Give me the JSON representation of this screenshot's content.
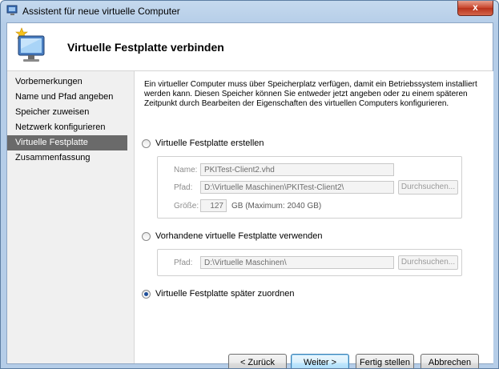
{
  "window": {
    "title": "Assistent für neue virtuelle Computer",
    "close_glyph": "x"
  },
  "header": {
    "title": "Virtuelle Festplatte verbinden"
  },
  "nav": {
    "items": [
      {
        "label": "Vorbemerkungen",
        "active": false
      },
      {
        "label": "Name und Pfad angeben",
        "active": false
      },
      {
        "label": "Speicher zuweisen",
        "active": false
      },
      {
        "label": "Netzwerk konfigurieren",
        "active": false
      },
      {
        "label": "Virtuelle Festplatte verbinden",
        "active": true
      },
      {
        "label": "Zusammenfassung",
        "active": false
      }
    ]
  },
  "content": {
    "description": "Ein virtueller Computer muss über Speicherplatz verfügen, damit ein Betriebssystem installiert werden kann. Diesen Speicher können Sie entweder jetzt angeben oder zu einem späteren Zeitpunkt durch Bearbeiten der Eigenschaften des virtuellen Computers konfigurieren.",
    "option_create": {
      "label": "Virtuelle Festplatte erstellen",
      "checked": false,
      "name_label": "Name:",
      "name_value": "PKITest-Client2.vhd",
      "path_label": "Pfad:",
      "path_value": "D:\\Virtuelle Maschinen\\PKITest-Client2\\",
      "browse_label": "Durchsuchen...",
      "size_label": "Größe:",
      "size_value": "127",
      "size_unit": "GB (Maximum: 2040 GB)"
    },
    "option_existing": {
      "label": "Vorhandene virtuelle Festplatte verwenden",
      "checked": false,
      "path_label": "Pfad:",
      "path_value": "D:\\Virtuelle Maschinen\\",
      "browse_label": "Durchsuchen..."
    },
    "option_later": {
      "label": "Virtuelle Festplatte später zuordnen",
      "checked": true
    }
  },
  "buttons": {
    "back": "< Zurück",
    "next": "Weiter >",
    "finish": "Fertig stellen",
    "cancel": "Abbrechen"
  },
  "colors": {
    "active_nav": "#6a6a6a",
    "window_frame": "#b5cde8",
    "close_button": "#c7432a"
  }
}
